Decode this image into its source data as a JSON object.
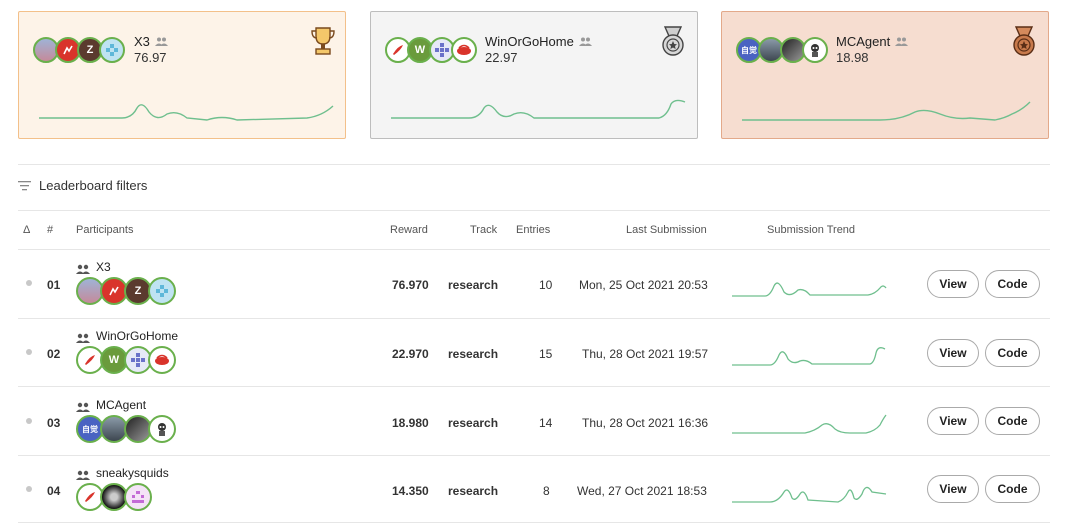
{
  "podium": [
    {
      "name": "X3",
      "score": "76.97",
      "medal": "trophy-icon",
      "bg": "#fdf3e8",
      "border": "#f3c08a"
    },
    {
      "name": "WinOrGoHome",
      "score": "22.97",
      "medal": "silver-medal-icon",
      "bg": "#f4f4f4",
      "border": "#bdbdbd"
    },
    {
      "name": "MCAgent",
      "score": "18.98",
      "medal": "bronze-medal-icon",
      "bg": "#f6ddd0",
      "border": "#e3a98a"
    }
  ],
  "filters_label": "Leaderboard filters",
  "columns": {
    "delta": "Δ",
    "rank": "#",
    "participants": "Participants",
    "reward": "Reward",
    "track": "Track",
    "entries": "Entries",
    "last_submission": "Last Submission",
    "trend": "Submission Trend"
  },
  "rows": [
    {
      "rank": "01",
      "name": "X3",
      "reward": "76.970",
      "track": "research",
      "entries": "10",
      "last": "Mon, 25 Oct 2021 20:53",
      "view": "View",
      "code": "Code"
    },
    {
      "rank": "02",
      "name": "WinOrGoHome",
      "reward": "22.970",
      "track": "research",
      "entries": "15",
      "last": "Thu, 28 Oct 2021 19:57",
      "view": "View",
      "code": "Code"
    },
    {
      "rank": "03",
      "name": "MCAgent",
      "reward": "18.980",
      "track": "research",
      "entries": "14",
      "last": "Thu, 28 Oct 2021 16:36",
      "view": "View",
      "code": "Code"
    },
    {
      "rank": "04",
      "name": "sneakysquids",
      "reward": "14.350",
      "track": "research",
      "entries": "8",
      "last": "Wed, 27 Oct 2021 18:53",
      "view": "View",
      "code": "Code"
    }
  ],
  "mcagent_avatar_text": "自觉",
  "avatar_letters": {
    "z": "Z",
    "w": "W"
  },
  "colors": {
    "accent_green": "#6ab04c",
    "trend_line": "#6fbf8e"
  }
}
